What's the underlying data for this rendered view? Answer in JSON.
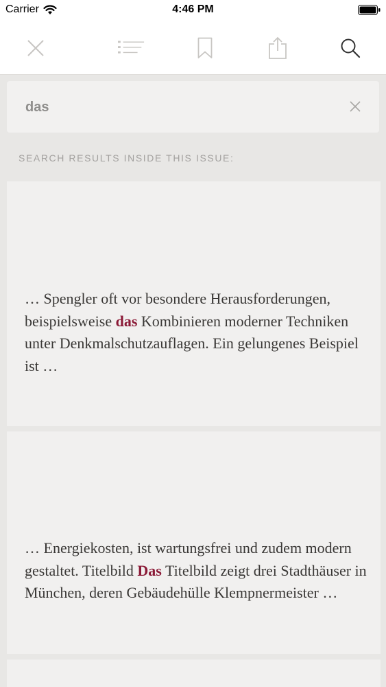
{
  "status_bar": {
    "carrier": "Carrier",
    "time": "4:46 PM"
  },
  "toolbar": {
    "icons": [
      "close-icon",
      "toc-list-icon",
      "bookmark-icon",
      "share-icon",
      "search-icon"
    ]
  },
  "search": {
    "query": "das"
  },
  "section": {
    "label": "SEARCH RESULTS INSIDE THIS ISSUE:"
  },
  "results": [
    {
      "before": "… Spengler oft vor besondere Herausforderungen, beispielsweise ",
      "match": "das",
      "after": " Kombinieren moderner Techniken unter Denkmalschutzauflagen. Ein gelungenes Beispiel ist …"
    },
    {
      "before": "… Energiekosten, ist wartungsfrei und zudem modern gestaltet. Titelbild ",
      "match": "Das",
      "after": " Titelbild zeigt drei Stadthäuser in München, deren Gebäudehülle Klempnermeister …"
    }
  ],
  "colors": {
    "highlight": "#8b1a37",
    "background": "#e8e7e5",
    "card": "#f1f0ef"
  }
}
